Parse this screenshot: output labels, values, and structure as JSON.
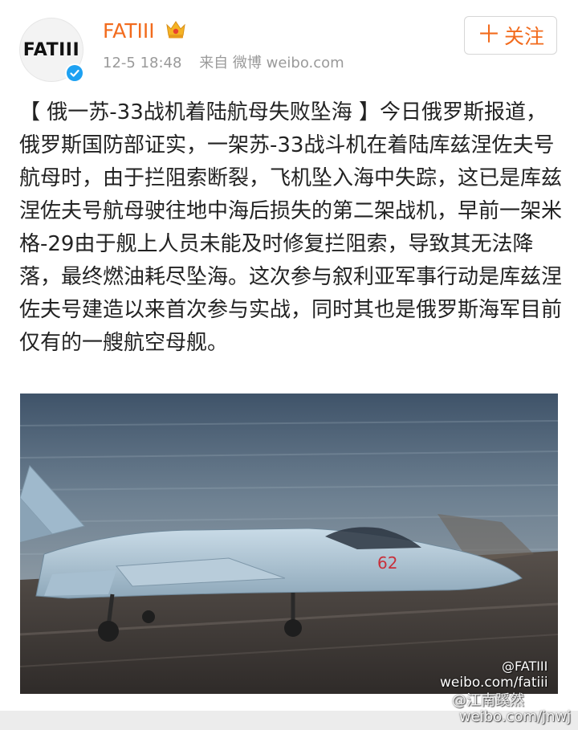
{
  "post": {
    "author": {
      "avatar_text": "FATIII",
      "name": "FATIII",
      "badge_icon": "crown-icon",
      "verified_icon": "verified-badge-icon",
      "verified_color": "#1da1f2"
    },
    "time": "12-5 18:48",
    "source": "来自 微博 weibo.com",
    "follow_button": {
      "plus": "＋",
      "label": "关注"
    },
    "text": "【 俄一苏-33战机着陆航母失败坠海 】今日俄罗斯报道，俄罗斯国防部证实，一架苏-33战斗机在着陆库兹涅佐夫号航母时，由于拦阻索断裂，飞机坠入海中失踪，这已是库兹涅佐夫号航母驶往地中海后损失的第二架战机，早前一架米格-29由于舰上人员未能及时修复拦阻索，导致其无法降落，最终燃油耗尽坠海。这次参与叙利亚军事行动是库兹涅佐夫号建造以来首次参与实战，同时其也是俄罗斯海军目前仅有的一艘航空母舰。",
    "photo": {
      "tail_number": "62"
    },
    "watermarks": {
      "line1": "@FATIII",
      "line2": "weibo.com/fatiii",
      "line3": "@江南蹊然",
      "line4": "weibo.com/jnwj"
    }
  },
  "colors": {
    "accent": "#f26b1d",
    "meta_text": "#9a9a9a",
    "body_text": "#222222"
  }
}
